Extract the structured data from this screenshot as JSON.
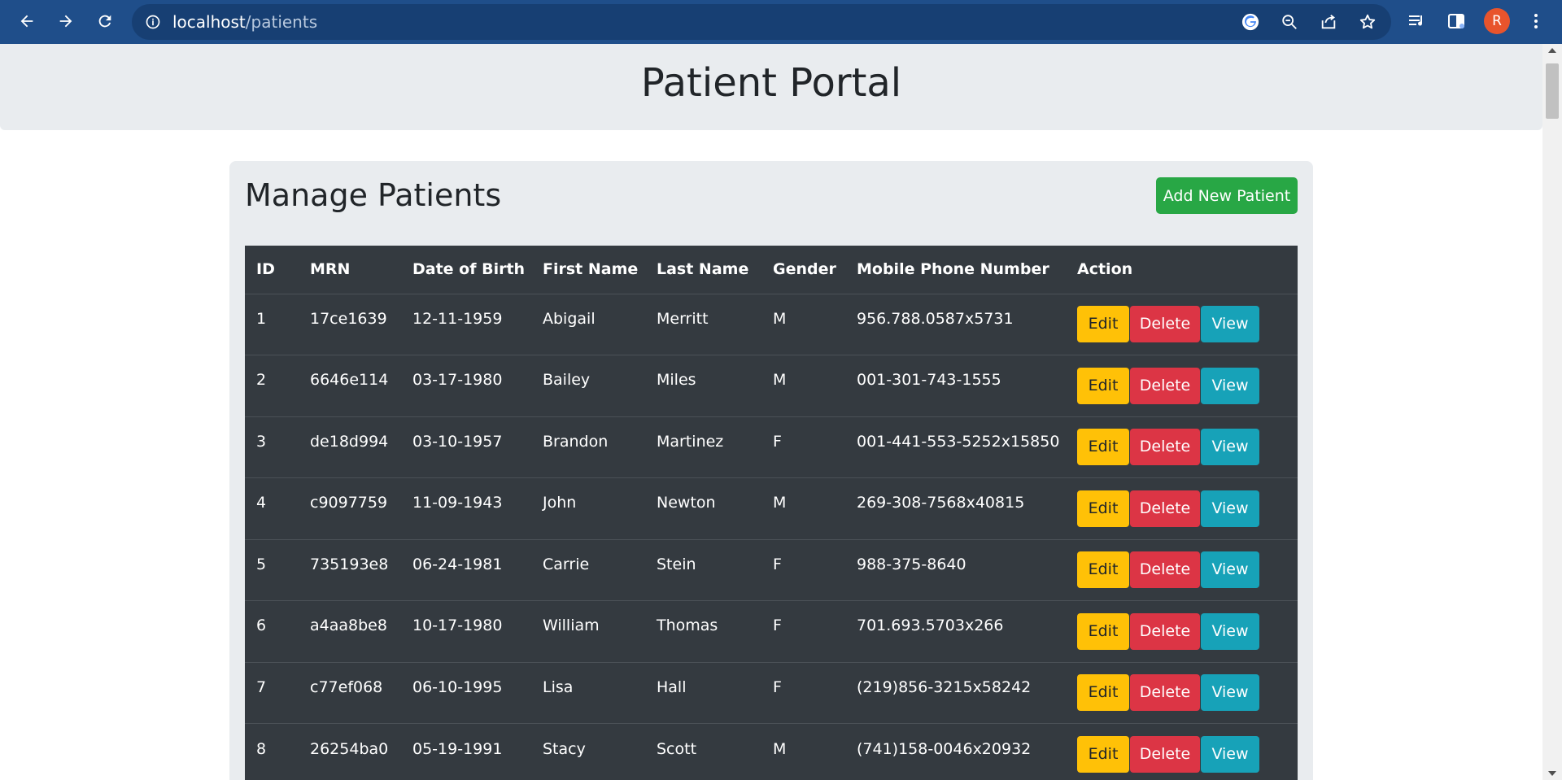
{
  "browser": {
    "url_host": "localhost",
    "url_path": "/patients",
    "profile_initial": "R"
  },
  "page": {
    "title": "Patient Portal",
    "panel_title": "Manage Patients",
    "add_button": "Add New Patient"
  },
  "table": {
    "headers": [
      "ID",
      "MRN",
      "Date of Birth",
      "First Name",
      "Last Name",
      "Gender",
      "Mobile Phone Number",
      "Action"
    ],
    "rows": [
      {
        "id": "1",
        "mrn": "17ce1639",
        "dob": "12-11-1959",
        "first": "Abigail",
        "last": "Merritt",
        "gender": "M",
        "phone": "956.788.0587x5731"
      },
      {
        "id": "2",
        "mrn": "6646e114",
        "dob": "03-17-1980",
        "first": "Bailey",
        "last": "Miles",
        "gender": "M",
        "phone": "001-301-743-1555"
      },
      {
        "id": "3",
        "mrn": "de18d994",
        "dob": "03-10-1957",
        "first": "Brandon",
        "last": "Martinez",
        "gender": "F",
        "phone": "001-441-553-5252x15850"
      },
      {
        "id": "4",
        "mrn": "c9097759",
        "dob": "11-09-1943",
        "first": "John",
        "last": "Newton",
        "gender": "M",
        "phone": "269-308-7568x40815"
      },
      {
        "id": "5",
        "mrn": "735193e8",
        "dob": "06-24-1981",
        "first": "Carrie",
        "last": "Stein",
        "gender": "F",
        "phone": "988-375-8640"
      },
      {
        "id": "6",
        "mrn": "a4aa8be8",
        "dob": "10-17-1980",
        "first": "William",
        "last": "Thomas",
        "gender": "F",
        "phone": "701.693.5703x266"
      },
      {
        "id": "7",
        "mrn": "c77ef068",
        "dob": "06-10-1995",
        "first": "Lisa",
        "last": "Hall",
        "gender": "F",
        "phone": "(219)856-3215x58242"
      },
      {
        "id": "8",
        "mrn": "26254ba0",
        "dob": "05-19-1991",
        "first": "Stacy",
        "last": "Scott",
        "gender": "M",
        "phone": "(741)158-0046x20932"
      }
    ],
    "actions": {
      "edit": "Edit",
      "delete": "Delete",
      "view": "View"
    }
  },
  "colors": {
    "chrome": "#1f4e8a",
    "add_button": "#28a745",
    "edit_button": "#ffc107",
    "delete_button": "#dc3545",
    "view_button": "#17a2b8",
    "table_bg": "#343a40"
  },
  "icons": [
    "back-icon",
    "forward-icon",
    "reload-icon",
    "info-icon",
    "google-icon",
    "zoom-out-icon",
    "share-icon",
    "bookmark-star-icon",
    "reading-list-icon",
    "side-panel-icon",
    "menu-dots-icon"
  ]
}
